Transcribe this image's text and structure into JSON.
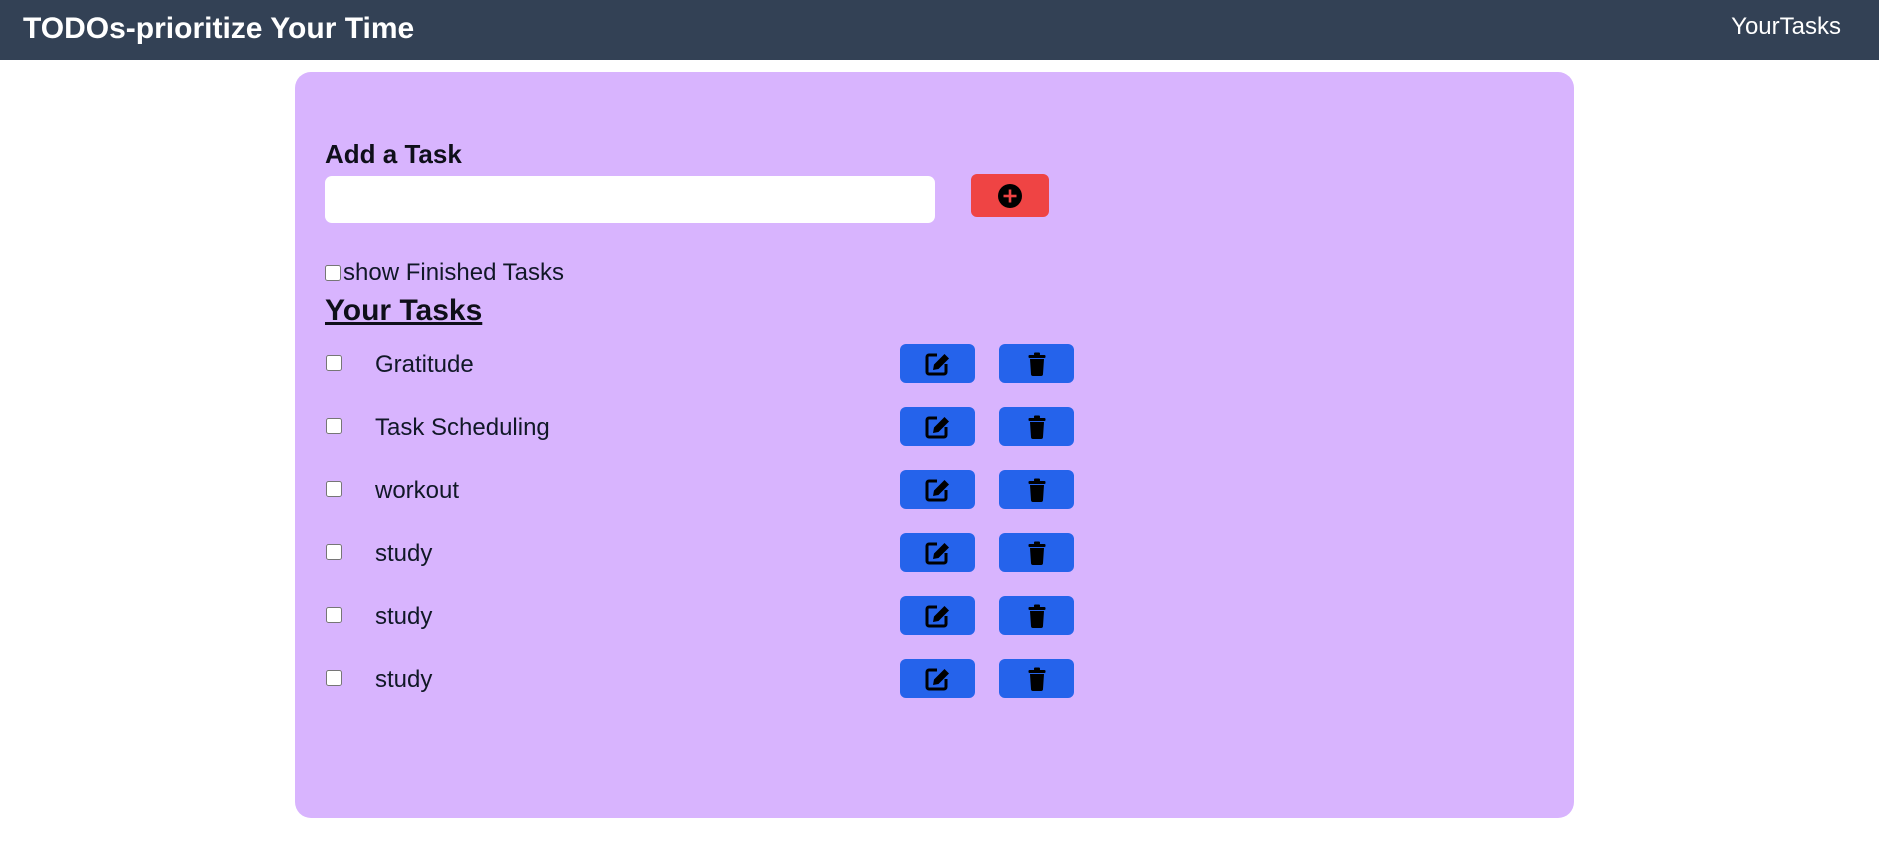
{
  "navbar": {
    "brand": "TODOs-prioritize Your Time",
    "link": "YourTasks"
  },
  "add_task": {
    "title": "Add a Task",
    "input_value": "",
    "add_button_icon": "plus-circle-icon",
    "add_button_color": "#ef4444"
  },
  "show_finished": {
    "label": "show Finished Tasks",
    "checked": false
  },
  "tasks_section": {
    "title": "Your Tasks"
  },
  "tasks": [
    {
      "text": "Gratitude",
      "done": false
    },
    {
      "text": "Task Scheduling",
      "done": false
    },
    {
      "text": "workout",
      "done": false
    },
    {
      "text": "study",
      "done": false
    },
    {
      "text": "study",
      "done": false
    },
    {
      "text": "study",
      "done": false
    }
  ],
  "task_actions": {
    "edit_icon": "edit-icon",
    "delete_icon": "trash-icon",
    "button_color": "#2563eb"
  },
  "colors": {
    "navbar_bg": "#334155",
    "panel_bg": "#d8b4fe"
  }
}
